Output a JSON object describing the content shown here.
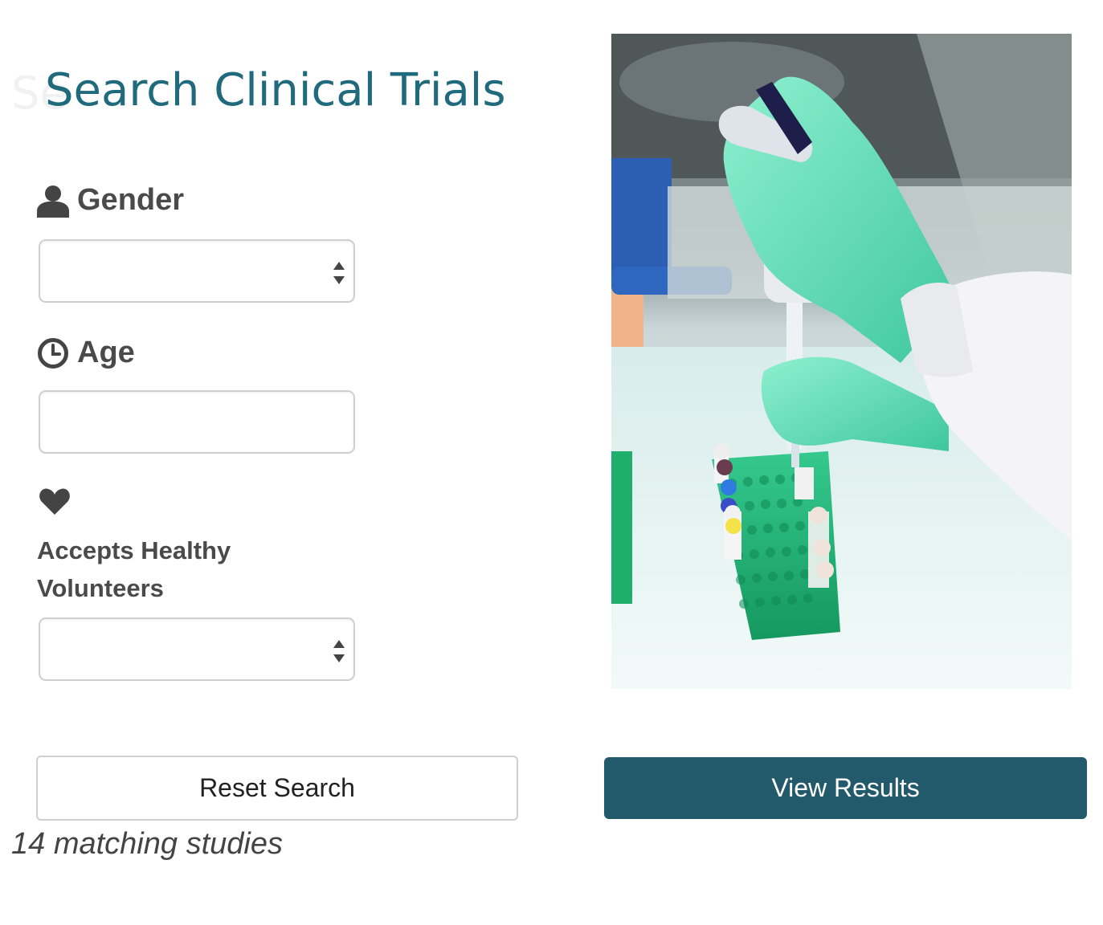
{
  "page": {
    "title": "Search Clinical Trials",
    "title_fragment": "Se"
  },
  "form": {
    "gender": {
      "label": "Gender",
      "icon": "person-icon",
      "value": ""
    },
    "age": {
      "label": "Age",
      "icon": "clock-icon",
      "value": ""
    },
    "healthy_volunteers": {
      "label": "Accepts Healthy Volunteers",
      "icon": "heart-icon",
      "value": ""
    }
  },
  "actions": {
    "reset_label": "Reset Search",
    "view_results_label": "View Results"
  },
  "results": {
    "count_text": "14 matching studies"
  },
  "image": {
    "subject": "gloved hand pipetting samples into a green tube rack"
  },
  "colors": {
    "title": "#1f6a7c",
    "primary_button": "#225a6b",
    "glove": "#6fdcb8",
    "rack": "#22b27a"
  }
}
